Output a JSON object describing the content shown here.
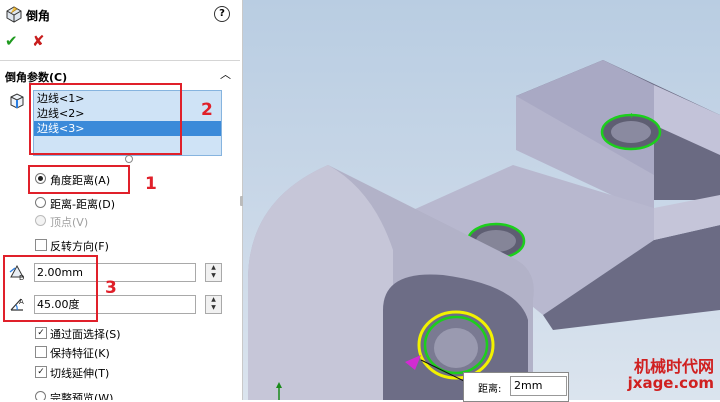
{
  "panel": {
    "title": "倒角",
    "help": "?",
    "ok": "✔",
    "cancel": "✘",
    "section": {
      "title": "倒角参数(C)",
      "edges": [
        "边线<1>",
        "边线<2>",
        "边线<3>"
      ],
      "selected_edge_index": 2
    },
    "type_options": {
      "angle_distance": "角度距离(A)",
      "distance_distance": "距离-距离(D)",
      "vertex": "顶点(V)"
    },
    "flip_direction": "反转方向(F)",
    "distance_value": "2.00mm",
    "angle_value": "45.00度",
    "options": {
      "select_through_faces": "通过面选择(S)",
      "keep_features": "保持特征(K)",
      "tangent_propagation": "切线延伸(T)",
      "full_preview": "完整预览(W)"
    }
  },
  "annotations": {
    "label1": "1",
    "label2": "2",
    "label3": "3"
  },
  "viewport": {
    "dimension_label": "距离:",
    "dimension_value": "2mm"
  },
  "watermark": {
    "line1": "机械时代网",
    "line2": "jxage.com"
  },
  "colors": {
    "accent_red": "#e0202a",
    "selection_blue": "#3b8ad9",
    "highlight_green": "#1ccf1c",
    "highlight_yellow": "#f2f200"
  }
}
